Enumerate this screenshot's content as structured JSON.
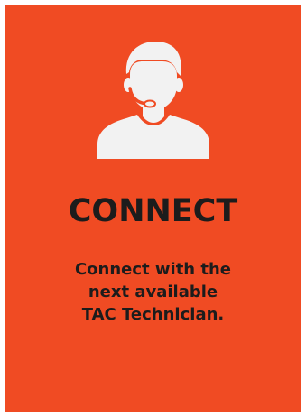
{
  "card": {
    "icon": "support-agent-headset-icon",
    "title": "CONNECT",
    "description_lines": [
      "Connect with the",
      "next available",
      "TAC Technician."
    ]
  },
  "colors": {
    "card_background": "#f04b23",
    "icon_color": "#f2f2f2",
    "text_color": "#1c1c1c"
  }
}
